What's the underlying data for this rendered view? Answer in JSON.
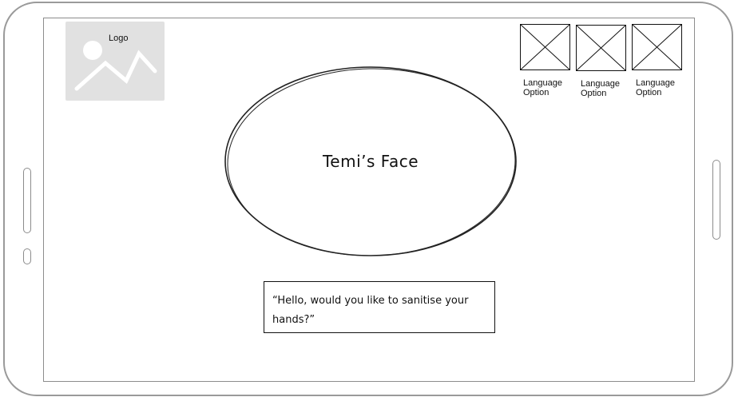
{
  "logo": {
    "label": "Logo",
    "icon": "image-placeholder-icon"
  },
  "language_options": [
    {
      "label": "Language Option",
      "icon": "image-placeholder-icon"
    },
    {
      "label": "Language Option",
      "icon": "image-placeholder-icon"
    },
    {
      "label": "Language Option",
      "icon": "image-placeholder-icon"
    }
  ],
  "face": {
    "label": "Temi’s Face"
  },
  "speech": {
    "text": "“Hello, would you like to sanitise your hands?”"
  }
}
